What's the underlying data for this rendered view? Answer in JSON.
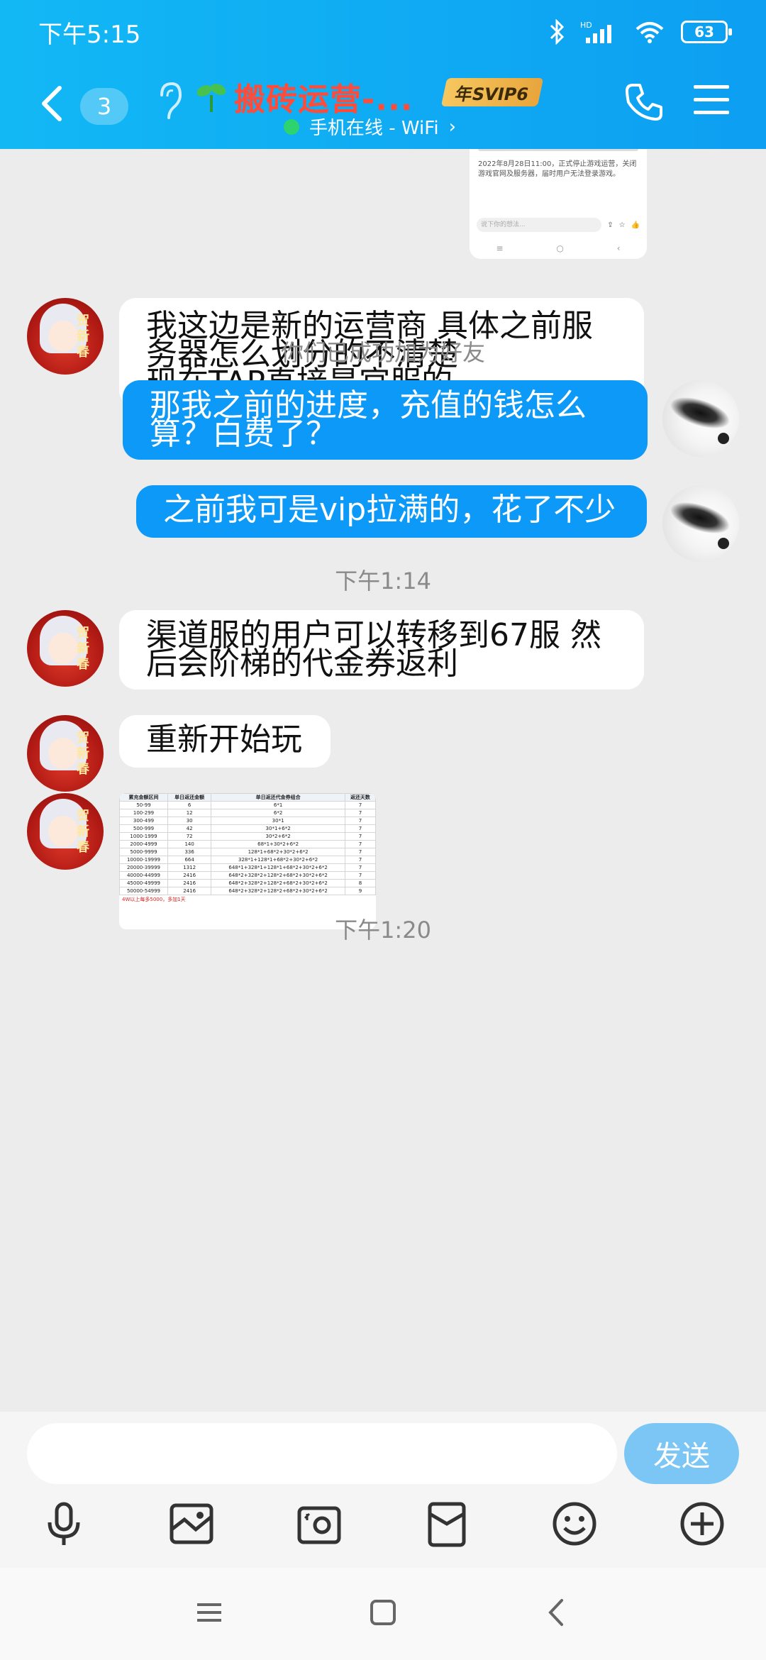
{
  "status_bar": {
    "time": "下午5:15",
    "battery": "63",
    "network_label": "HD"
  },
  "header": {
    "unread_count": "3",
    "title": "搬砖运营-...",
    "svip_label": "年SVIP6",
    "subtitle": "手机在线 - WiFi",
    "subtitle_chevron": "›"
  },
  "shared_image": {
    "text_1": "2022年8月28日11:00，正式停止游戏运营，关闭游戏官网及服务器，届时用户无法登录游戏。",
    "placeholder": "说下你的想法..."
  },
  "messages": [
    {
      "id": 1,
      "direction": "in",
      "avatar": "girl-avatar",
      "lines": [
        "我这边是新的运营商 具体之前服",
        "务器怎么划分的不清楚",
        "现在TAP直接是官服的"
      ]
    },
    {
      "id": 2,
      "direction": "system",
      "text": "你们已成功加为好友"
    },
    {
      "id": 3,
      "direction": "out",
      "avatar": "feather-avatar",
      "lines": [
        "那我之前的进度，充值的钱怎么",
        "算？白费了？"
      ]
    },
    {
      "id": 4,
      "direction": "out",
      "avatar": "feather-avatar",
      "lines": [
        "之前我可是vip拉满的，花了不少"
      ]
    },
    {
      "id": 5,
      "direction": "time",
      "text": "下午1:14"
    },
    {
      "id": 6,
      "direction": "in",
      "avatar": "girl-avatar",
      "lines": [
        "渠道服的用户可以转移到67服 然",
        "后会阶梯的代金券返利"
      ]
    },
    {
      "id": 7,
      "direction": "in",
      "avatar": "girl-avatar",
      "lines": [
        "重新开始玩"
      ]
    },
    {
      "id": 8,
      "direction": "in",
      "avatar": "girl-avatar",
      "type": "image"
    },
    {
      "id": 9,
      "direction": "time",
      "text": "下午1:20"
    }
  ],
  "avatar_stamp": "贺新春",
  "rebate_table": {
    "headers": [
      "累充金额区间",
      "单日返还金额",
      "单日返还代金券组合",
      "返还天数"
    ],
    "rows": [
      [
        "50-99",
        "6",
        "6*1",
        "7"
      ],
      [
        "100-299",
        "12",
        "6*2",
        "7"
      ],
      [
        "300-499",
        "30",
        "30*1",
        "7"
      ],
      [
        "500-999",
        "42",
        "30*1+6*2",
        "7"
      ],
      [
        "1000-1999",
        "72",
        "30*2+6*2",
        "7"
      ],
      [
        "2000-4999",
        "140",
        "68*1+30*2+6*2",
        "7"
      ],
      [
        "5000-9999",
        "336",
        "128*1+68*2+30*2+6*2",
        "7"
      ],
      [
        "10000-19999",
        "664",
        "328*1+128*1+68*2+30*2+6*2",
        "7"
      ],
      [
        "20000-39999",
        "1312",
        "648*1+328*1+128*1+68*2+30*2+6*2",
        "7"
      ],
      [
        "40000-44999",
        "2416",
        "648*2+328*2+128*2+68*2+30*2+6*2",
        "7"
      ],
      [
        "45000-49999",
        "2416",
        "648*2+328*2+128*2+68*2+30*2+6*2",
        "8"
      ],
      [
        "50000-54999",
        "2416",
        "648*2+328*2+128*2+68*2+30*2+6*2",
        "9"
      ]
    ],
    "footnote": "4W以上每多5000，多加1天"
  },
  "composer": {
    "input_value": "",
    "send_label": "发送"
  },
  "colors": {
    "header": "#0d9ff2",
    "bubble_out": "#0c99f7",
    "send_button": "#7cc6f5",
    "title": "#ff4b3a"
  }
}
